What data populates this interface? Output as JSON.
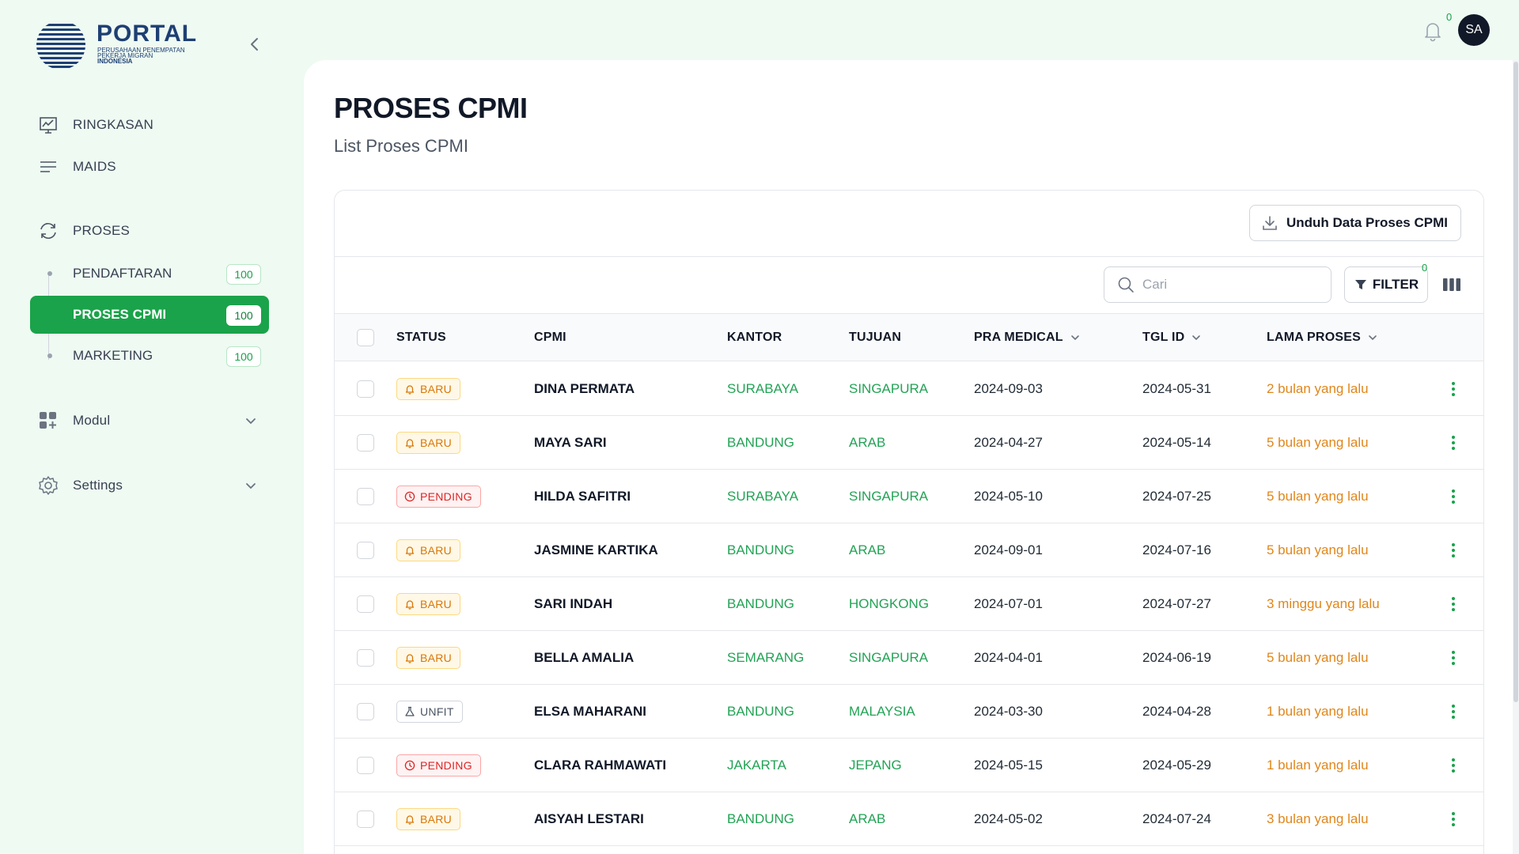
{
  "brand": {
    "title": "PORTAL",
    "subtitle_lines": [
      "PERUSAHAAN PENEMPATAN",
      "PEKERJA MIGRAN",
      "INDONESIA"
    ],
    "color": "#1d3f73"
  },
  "sidebar": {
    "items": [
      {
        "label": "RINGKASAN",
        "icon": "chart-presentation-icon"
      },
      {
        "label": "MAIDS",
        "icon": "list-lines-icon"
      },
      {
        "label": "PROSES",
        "icon": "refresh-cycle-icon"
      }
    ],
    "proses_sub": [
      {
        "label": "PENDAFTARAN",
        "count": "100"
      },
      {
        "label": "PROSES CPMI",
        "count": "100",
        "active": true
      },
      {
        "label": "MARKETING",
        "count": "100"
      }
    ],
    "groups": [
      {
        "label": "Modul",
        "icon": "grid-plus-icon"
      },
      {
        "label": "Settings",
        "icon": "gear-icon"
      }
    ],
    "accent": "#1aa34a"
  },
  "topbar": {
    "notification_count": "0",
    "avatar_initials": "SA"
  },
  "page": {
    "title": "PROSES CPMI",
    "subtitle": "List Proses CPMI"
  },
  "toolbar": {
    "download_label": "Unduh Data Proses CPMI",
    "search_placeholder": "Cari",
    "filter_label": "FILTER",
    "filter_count": "0"
  },
  "table": {
    "columns": {
      "status": "STATUS",
      "cpmi": "CPMI",
      "kantor": "KANTOR",
      "tujuan": "TUJUAN",
      "pra_medical": "PRA MEDICAL",
      "tgl_id": "TGL ID",
      "lama_proses": "LAMA PROSES"
    },
    "rows": [
      {
        "status": "BARU",
        "status_type": "baru",
        "cpmi": "DINA PERMATA",
        "kantor": "SURABAYA",
        "tujuan": "SINGAPURA",
        "pra_medical": "2024-09-03",
        "tgl_id": "2024-05-31",
        "lama_proses": "2 bulan yang lalu"
      },
      {
        "status": "BARU",
        "status_type": "baru",
        "cpmi": "MAYA SARI",
        "kantor": "BANDUNG",
        "tujuan": "ARAB",
        "pra_medical": "2024-04-27",
        "tgl_id": "2024-05-14",
        "lama_proses": "5 bulan yang lalu"
      },
      {
        "status": "PENDING",
        "status_type": "pending",
        "cpmi": "HILDA SAFITRI",
        "kantor": "SURABAYA",
        "tujuan": "SINGAPURA",
        "pra_medical": "2024-05-10",
        "tgl_id": "2024-07-25",
        "lama_proses": "5 bulan yang lalu"
      },
      {
        "status": "BARU",
        "status_type": "baru",
        "cpmi": "JASMINE KARTIKA",
        "kantor": "BANDUNG",
        "tujuan": "ARAB",
        "pra_medical": "2024-09-01",
        "tgl_id": "2024-07-16",
        "lama_proses": "5 bulan yang lalu"
      },
      {
        "status": "BARU",
        "status_type": "baru",
        "cpmi": "SARI INDAH",
        "kantor": "BANDUNG",
        "tujuan": "HONGKONG",
        "pra_medical": "2024-07-01",
        "tgl_id": "2024-07-27",
        "lama_proses": "3 minggu yang lalu"
      },
      {
        "status": "BARU",
        "status_type": "baru",
        "cpmi": "BELLA AMALIA",
        "kantor": "SEMARANG",
        "tujuan": "SINGAPURA",
        "pra_medical": "2024-04-01",
        "tgl_id": "2024-06-19",
        "lama_proses": "5 bulan yang lalu"
      },
      {
        "status": "UNFIT",
        "status_type": "unfit",
        "cpmi": "ELSA MAHARANI",
        "kantor": "BANDUNG",
        "tujuan": "MALAYSIA",
        "pra_medical": "2024-03-30",
        "tgl_id": "2024-04-28",
        "lama_proses": "1 bulan yang lalu"
      },
      {
        "status": "PENDING",
        "status_type": "pending",
        "cpmi": "CLARA RAHMAWATI",
        "kantor": "JAKARTA",
        "tujuan": "JEPANG",
        "pra_medical": "2024-05-15",
        "tgl_id": "2024-05-29",
        "lama_proses": "1 bulan yang lalu"
      },
      {
        "status": "BARU",
        "status_type": "baru",
        "cpmi": "AISYAH LESTARI",
        "kantor": "BANDUNG",
        "tujuan": "ARAB",
        "pra_medical": "2024-05-02",
        "tgl_id": "2024-07-24",
        "lama_proses": "3 bulan yang lalu"
      }
    ]
  }
}
